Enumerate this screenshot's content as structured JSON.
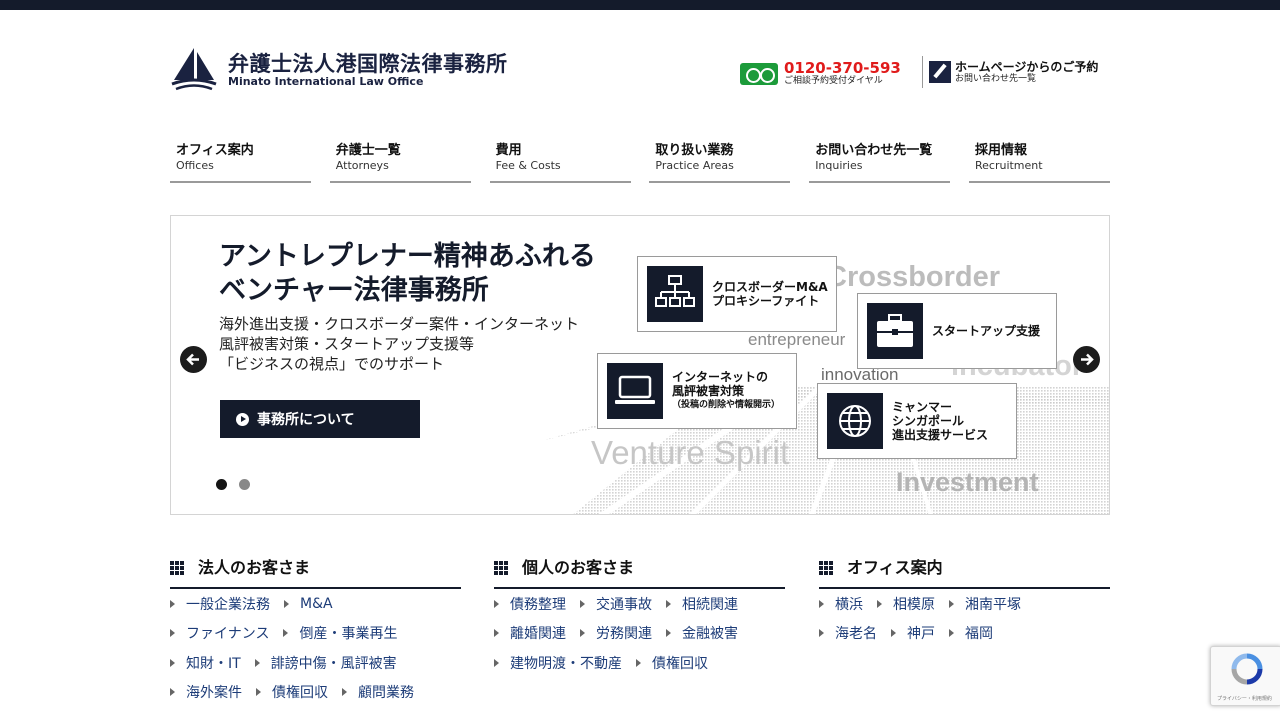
{
  "header": {
    "firm_name_jp": "弁護士法人港国際法律事務所",
    "firm_name_en": "Minato International Law Office",
    "tel_number": "0120-370-593",
    "tel_caption": "ご相談予約受付ダイヤル",
    "reserve_label": "ホームページからのご予約",
    "reserve_caption": "お問い合わせ先一覧"
  },
  "nav": [
    {
      "jp": "オフィス案内",
      "en": "Offices"
    },
    {
      "jp": "弁護士一覧",
      "en": "Attorneys"
    },
    {
      "jp": "費用",
      "en": "Fee & Costs"
    },
    {
      "jp": "取り扱い業務",
      "en": "Practice Areas"
    },
    {
      "jp": "お問い合わせ先一覧",
      "en": "Inquiries"
    },
    {
      "jp": "採用情報",
      "en": "Recruitment"
    }
  ],
  "hero": {
    "title_line1": "アントレプレナー精神あふれる",
    "title_line2": "ベンチャー法律事務所",
    "desc_line1": "海外進出支援・クロスボーダー案件・インターネット",
    "desc_line2": "風評被害対策・スタートアップ支援等",
    "desc_line3": "「ビジネスの視点」でのサポート",
    "button_label": "事務所について",
    "words": {
      "crossborder": "Crossborder",
      "entrepreneur": "entrepreneur",
      "incubator": "incubator",
      "innovation": "innovation",
      "venture": "Venture Spirit",
      "investment": "Investment"
    },
    "cards": [
      {
        "line1": "クロスボーダーM&A",
        "line2": "プロキシーファイト",
        "icon": "org-chart-icon"
      },
      {
        "line1": "スタートアップ支援",
        "line2": "",
        "icon": "briefcase-icon"
      },
      {
        "line1": "インターネットの",
        "line2": "風評被害対策",
        "note": "（投稿の削除や情報開示）",
        "icon": "laptop-icon"
      },
      {
        "line1": "ミャンマー",
        "line2": "シンガポール",
        "line3": "進出支援サービス",
        "icon": "globe-icon"
      }
    ],
    "active_slide": 1,
    "slide_count": 2
  },
  "categories": [
    {
      "title": "法人のお客さま",
      "rows": [
        [
          "一般企業法務",
          "M&A"
        ],
        [
          "ファイナンス",
          "倒産・事業再生"
        ],
        [
          "知財・IT",
          "誹謗中傷・風評被害"
        ],
        [
          "海外案件",
          "債権回収",
          "顧問業務"
        ]
      ]
    },
    {
      "title": "個人のお客さま",
      "rows": [
        [
          "債務整理",
          "交通事故",
          "相続関連"
        ],
        [
          "離婚関連",
          "労務関連",
          "金融被害"
        ],
        [
          "建物明渡・不動産",
          "債権回収"
        ]
      ]
    },
    {
      "title": "オフィス案内",
      "rows": [
        [
          "横浜",
          "相模原",
          "湘南平塚"
        ],
        [
          "海老名",
          "神戸",
          "福岡"
        ]
      ]
    }
  ],
  "recaptcha": {
    "terms": "プライバシー・利用規約"
  },
  "colors": {
    "navy": "#141b2b",
    "tel_red": "#e01b1b",
    "freedial_green": "#1c9b3a",
    "link": "#1d3c78"
  }
}
